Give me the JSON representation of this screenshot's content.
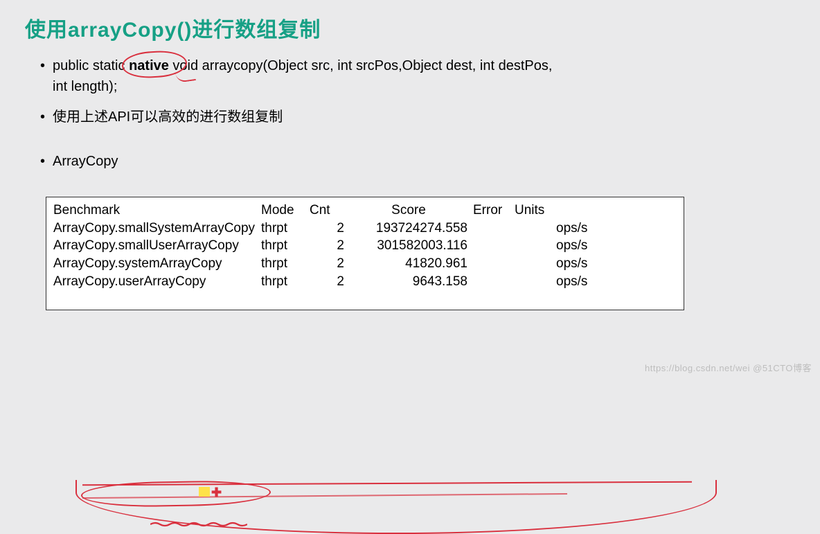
{
  "title": "使用arrayCopy()进行数组复制",
  "bullets": {
    "sig_pre": "public static ",
    "sig_native": "native",
    "sig_post": " void arraycopy(Object src,  int  srcPos,Object dest, int destPos,",
    "sig_cont": "int length);",
    "api_note": "使用上述API可以高效的进行数组复制",
    "arraycopy": "ArrayCopy"
  },
  "bench": {
    "headers": {
      "name": "Benchmark",
      "mode": "Mode",
      "cnt": "Cnt",
      "score": "Score",
      "error": "Error",
      "units": "Units"
    },
    "rows": [
      {
        "name": "ArrayCopy.smallSystemArrayCopy",
        "mode": "thrpt",
        "cnt": "2",
        "score": "193724274.558",
        "error": "",
        "units": "ops/s"
      },
      {
        "name": "ArrayCopy.smallUserArrayCopy",
        "mode": "thrpt",
        "cnt": "2",
        "score": "301582003.116",
        "error": "",
        "units": "ops/s"
      },
      {
        "name": "ArrayCopy.systemArrayCopy",
        "mode": "thrpt",
        "cnt": "2",
        "score": "41820.961",
        "error": "",
        "units": "ops/s"
      },
      {
        "name": "ArrayCopy.userArrayCopy",
        "mode": "thrpt",
        "cnt": "2",
        "score": "9643.158",
        "error": "",
        "units": "ops/s"
      }
    ]
  },
  "watermark": "https://blog.csdn.net/wei  @51CTO博客"
}
